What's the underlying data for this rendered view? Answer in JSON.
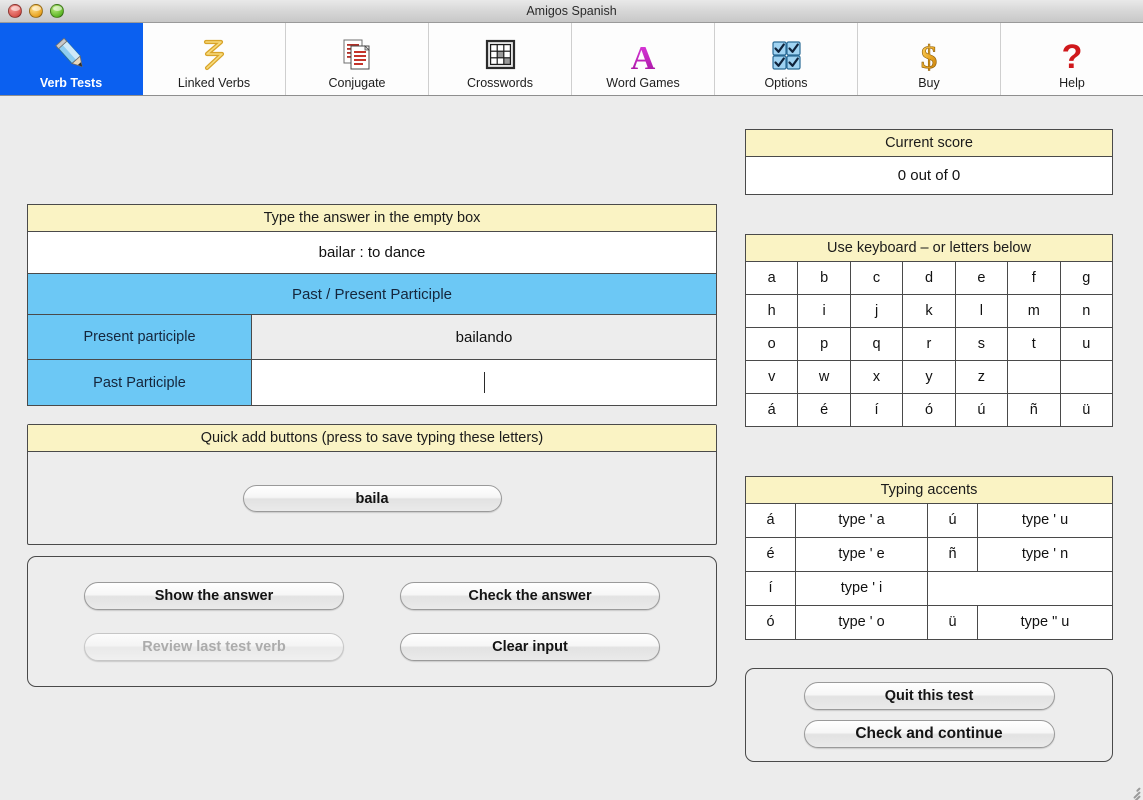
{
  "window": {
    "title": "Amigos Spanish",
    "controls": [
      "close",
      "minimize",
      "zoom"
    ]
  },
  "toolbar": {
    "tabs": [
      {
        "label": "Verb Tests",
        "icon": "pencil-icon",
        "selected": true
      },
      {
        "label": "Linked Verbs",
        "icon": "linked-verbs-icon",
        "selected": false
      },
      {
        "label": "Conjugate",
        "icon": "documents-icon",
        "selected": false
      },
      {
        "label": "Crosswords",
        "icon": "grid-icon",
        "selected": false
      },
      {
        "label": "Word Games",
        "icon": "letter-a-icon",
        "selected": false
      },
      {
        "label": "Options",
        "icon": "checkboxes-icon",
        "selected": false
      },
      {
        "label": "Buy",
        "icon": "dollar-icon",
        "selected": false
      },
      {
        "label": "Help",
        "icon": "question-mark-icon",
        "selected": false
      }
    ]
  },
  "verb_test": {
    "title": "Type the answer in the empty box",
    "prompt": "bailar :  to dance",
    "section_header": "Past / Present Participle",
    "rows": [
      {
        "label": "Present participle",
        "value": "bailando",
        "editable": false
      },
      {
        "label": "Past Participle",
        "value": "",
        "editable": true
      }
    ]
  },
  "quick_add": {
    "title": "Quick add buttons (press to save typing these letters)",
    "buttons": [
      "baila"
    ]
  },
  "actions": {
    "show_answer": "Show the answer",
    "check_answer": "Check the answer",
    "review_last": "Review last test verb",
    "clear_input": "Clear input",
    "review_last_disabled": true
  },
  "score": {
    "title": "Current score",
    "value": "0 out of 0"
  },
  "keyboard": {
    "title": "Use keyboard – or letters below",
    "rows": [
      [
        "a",
        "b",
        "c",
        "d",
        "e",
        "f",
        "g"
      ],
      [
        "h",
        "i",
        "j",
        "k",
        "l",
        "m",
        "n"
      ],
      [
        "o",
        "p",
        "q",
        "r",
        "s",
        "t",
        "u"
      ],
      [
        "v",
        "w",
        "x",
        "y",
        "z",
        "",
        ""
      ],
      [
        "á",
        "é",
        "í",
        "ó",
        "ú",
        "ñ",
        "ü"
      ]
    ]
  },
  "accents": {
    "title": "Typing accents",
    "rows": [
      {
        "c1": "á",
        "c2": "type ' a",
        "c3": "ú",
        "c4": "type ' u"
      },
      {
        "c1": "é",
        "c2": "type ' e",
        "c3": "ñ",
        "c4": "type ' n"
      },
      {
        "c1": "í",
        "c2": "type ' i",
        "c3": "",
        "c4": ""
      },
      {
        "c1": "ó",
        "c2": "type ' o",
        "c3": "ü",
        "c4": "type \" u"
      }
    ]
  },
  "bottom_actions": {
    "quit": "Quit this test",
    "check_continue": "Check and continue"
  },
  "colors": {
    "selected_tab": "#0B60F0",
    "header_yellow": "#faf3c4",
    "section_blue": "#6CC8F5",
    "window_bg": "#ececec"
  }
}
